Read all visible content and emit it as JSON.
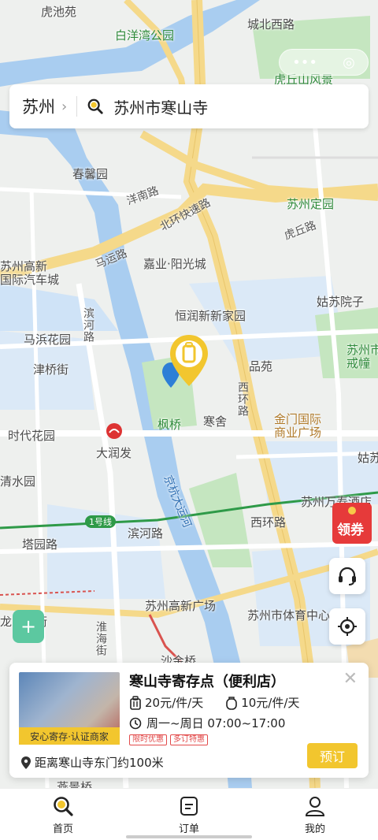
{
  "map": {
    "labels": {
      "huchiyuan": "虎池苑",
      "baiyangwan_park": "白洋湾公园",
      "chengbei_road": "城北西路",
      "huqiushan": "虎丘山风景",
      "chunxinyuan": "春馨园",
      "yangnan_road": "洋南路",
      "beihuan_expressway": "北环快速路",
      "suzhou_dingyuan": "苏州定园",
      "huqiu_road": "虎丘路",
      "mayun_road": "马运路",
      "jiaye_yangguangcheng": "嘉业·阳光城",
      "suzhou_gaoxin_bus": "苏州高新\n国际汽车城",
      "hengrun": "恒润新新家园",
      "gusu_yuanzi": "姑苏院子",
      "binhe_road_v": "滨河路",
      "mabin_garden": "马浜花园",
      "pinyuan": "品苑",
      "suzhou_jiezhuang": "苏州市\n戒幢",
      "jinqiao_street": "津桥街",
      "xihuan_road_v": "西环路",
      "fengqiao": "枫桥",
      "hanshe": "寒舍",
      "jinmen_plaza": "金门国际\n商业广场",
      "shidai_garden": "时代花园",
      "darunfa": "大润发",
      "gusu": "姑苏",
      "qingshuiyuan": "清水园",
      "jinghang_canal": "京杭大运河",
      "suzhou_wanshou": "苏州万寿酒店",
      "line1": "1号线",
      "tayuan_road": "塔园路",
      "binhe_road": "滨河路",
      "xihuan_road": "西环路",
      "suzhou_gaoxin_plaza": "苏州高新广场",
      "suzhou_sports": "苏州市体育中心",
      "longtian_street": "龙门天街",
      "huaihai_street": "淮海街",
      "shajinqiao": "沙金桥",
      "yanqiao": "燕景桥"
    }
  },
  "top": {
    "city": "苏州",
    "search_text": "苏州市寒山寺"
  },
  "side": {
    "coupon_label": "领券"
  },
  "card": {
    "name": "寒山寺寄存点（便利店）",
    "price_small": "20元/件/天",
    "price_large": "10元/件/天",
    "hours": "周一~周日 07:00~17:00",
    "tags": [
      "限时优惠",
      "多订特惠"
    ],
    "badge": "安心寄存·认证商家",
    "distance": "距离寒山寺东门约100米",
    "book_label": "预订"
  },
  "tabs": [
    {
      "label": "首页",
      "icon": "search-icon"
    },
    {
      "label": "订单",
      "icon": "order-icon"
    },
    {
      "label": "我的",
      "icon": "user-icon"
    }
  ],
  "colors": {
    "accent": "#f2c62e",
    "water": "#a9cdf0",
    "park": "#c5e6c0",
    "road_major": "#f5d98a",
    "metro": "#2e9a48"
  }
}
